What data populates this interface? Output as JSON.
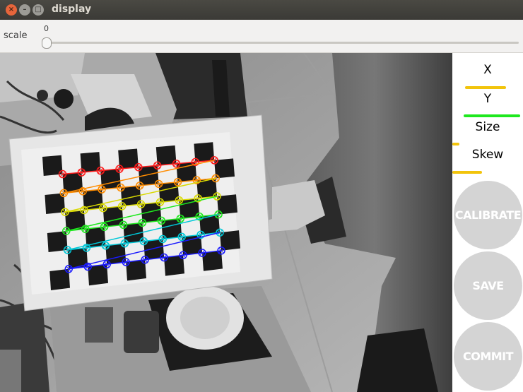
{
  "window": {
    "title": "display"
  },
  "toolbar": {
    "scale_label": "scale",
    "scale_value": "0"
  },
  "progress": {
    "x_label": "X",
    "x_level": 0.58,
    "y_label": "Y",
    "y_level": 0.8,
    "size_label": "Size",
    "size_level": 0.1,
    "skew_label": "Skew",
    "skew_level": 0.42
  },
  "buttons": {
    "calibrate": "CALIBRATE",
    "save": "SAVE",
    "commit": "COMMIT"
  },
  "colors": {
    "bar_yellow": "#f2c40c",
    "bar_green": "#1ee81e",
    "button_grey": "#d4d4d4"
  },
  "detection": {
    "rows": 6,
    "cols": 9,
    "row_colors": [
      "#ff1a1a",
      "#ff8c00",
      "#d9d900",
      "#1ee81e",
      "#00c8d8",
      "#1a1aff"
    ]
  }
}
